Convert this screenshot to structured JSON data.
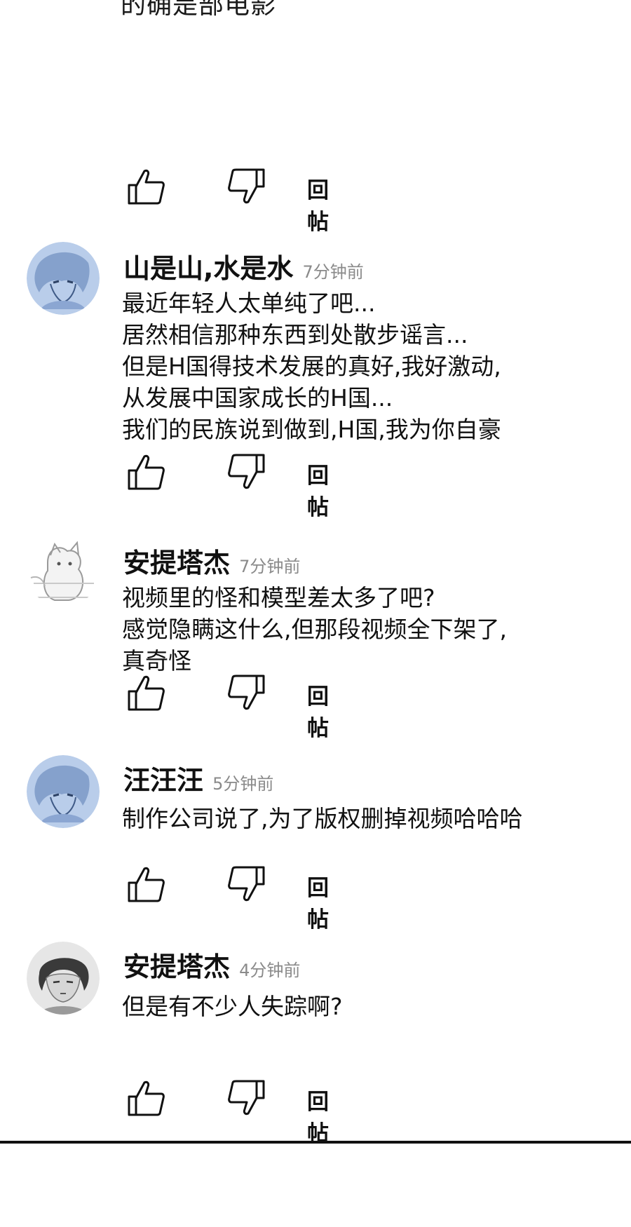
{
  "top_fragment": "的确是部电影",
  "reply_label": "回帖",
  "comments": [
    {
      "username": "山是山,水是水",
      "time": "7分钟前",
      "text": "最近年轻人太单纯了吧...\n居然相信那种东西到处散步谣言...\n但是H国得技术发展的真好,我好激动,\n从发展中国家成长的H国...\n我们的民族说到做到,H国,我为你自豪",
      "avatar": "anime-boy-avatar-blue"
    },
    {
      "username": "安提塔杰",
      "time": "7分钟前",
      "text": "视频里的怪和模型差太多了吧?\n感觉隐瞒这什么,但那段视频全下架了,\n真奇怪",
      "avatar": "white-cat-avatar"
    },
    {
      "username": "汪汪汪",
      "time": "5分钟前",
      "text": "制作公司说了,为了版权删掉视频哈哈哈",
      "avatar": "anime-boy-avatar-blue"
    },
    {
      "username": "安提塔杰",
      "time": "4分钟前",
      "text": "但是有不少人失踪啊?",
      "avatar": "man-portrait-avatar-gray"
    }
  ],
  "colors": {
    "text": "#111111",
    "timestamp": "#8a8a8a",
    "avatar_blue": "#b9cdea",
    "divider": "#111111"
  },
  "icons": {
    "like": "thumbs-up-icon",
    "dislike": "thumbs-down-icon"
  }
}
